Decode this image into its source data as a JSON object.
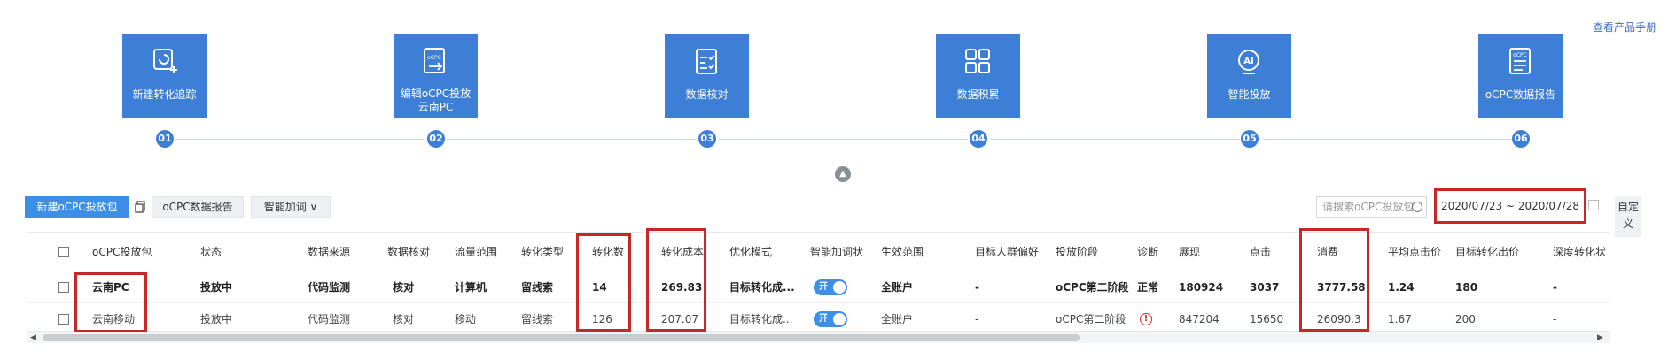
{
  "header": {
    "manual_link": "查看产品手册"
  },
  "steps": [
    {
      "label": "新建转化追踪",
      "num": "01",
      "icon": "target-add-icon"
    },
    {
      "label": "编辑oCPC投放",
      "label2": "云南PC",
      "num": "02",
      "icon": "ocpc-edit-icon"
    },
    {
      "label": "数据核对",
      "num": "03",
      "icon": "checklist-icon"
    },
    {
      "label": "数据积累",
      "num": "04",
      "icon": "grid-icon"
    },
    {
      "label": "智能投放",
      "num": "05",
      "icon": "ai-icon"
    },
    {
      "label": "oCPC数据报告",
      "num": "06",
      "icon": "report-icon"
    }
  ],
  "toolbar": {
    "new_package": "新建oCPC投放包",
    "report": "oCPC数据报告",
    "smart_bid": "智能加词 ∨",
    "search_placeholder": "请搜索oCPC投放包",
    "date_range": "2020/07/23 ~ 2020/07/28",
    "customize": "自定义"
  },
  "table": {
    "columns": [
      "oCPC投放包",
      "状态",
      "数据来源",
      "数据核对",
      "流量范围",
      "转化类型",
      "转化数",
      "转化成本",
      "优化模式",
      "智能加词状",
      "生效范围",
      "目标人群偏好",
      "投放阶段",
      "诊断",
      "展现",
      "点击",
      "消费",
      "平均点击价",
      "目标转化出价",
      "深度转化状"
    ],
    "rows": [
      [
        "云南PC",
        "投放中",
        "代码监测",
        "核对",
        "计算机",
        "留线索",
        "14",
        "269.83",
        "目标转化成...",
        "开",
        "全账户",
        "-",
        "oCPC第二阶段",
        "正常",
        "180924",
        "3037",
        "3777.58",
        "1.24",
        "180",
        "-"
      ],
      [
        "云南移动",
        "投放中",
        "代码监测",
        "核对",
        "移动",
        "留线索",
        "126",
        "207.07",
        "目标转化成...",
        "开",
        "全账户",
        "-",
        "oCPC第二阶段",
        "!",
        "847204",
        "15650",
        "26090.3",
        "1.67",
        "200",
        "-"
      ]
    ]
  },
  "colors": {
    "primary": "#3d7ed6",
    "highlight": "#c62828",
    "link": "#2f6fc4"
  }
}
